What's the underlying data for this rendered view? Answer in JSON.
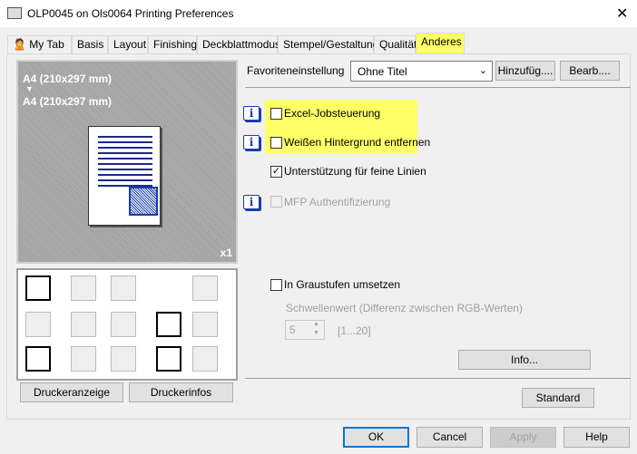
{
  "window": {
    "title": "OLP0045 on Ols0064 Printing Preferences",
    "close": "✕"
  },
  "tabs": [
    "My Tab",
    "Basis",
    "Layout",
    "Finishing",
    "Deckblattmodus",
    "Stempel/Gestaltung",
    "Qualität",
    "Anderes"
  ],
  "preview": {
    "paper_from": "A4 (210x297 mm)",
    "arrow": "▼",
    "paper_to": "A4 (210x297 mm)",
    "copies": "x1"
  },
  "left_buttons": {
    "printer_view": "Druckeranzeige",
    "printer_info": "Druckerinfos"
  },
  "favorites": {
    "label": "Favoriteneinstellung",
    "value": "Ohne Titel",
    "add": "Hinzufüg....",
    "edit": "Bearb...."
  },
  "options": [
    {
      "label": "Excel-Jobsteuerung",
      "checked": false,
      "enabled": true,
      "info": "i"
    },
    {
      "label": "Weißen Hintergrund entfernen",
      "checked": false,
      "enabled": true,
      "info": "i"
    },
    {
      "label": "Unterstützung für feine Linien",
      "checked": true,
      "enabled": true
    },
    {
      "label": "MFP Authentifizierung",
      "checked": false,
      "enabled": false,
      "info": "i"
    }
  ],
  "grayscale": {
    "label": "In Graustufen umsetzen",
    "threshold_label": "Schwellenwert (Differenz zwischen RGB-Werten)",
    "value": "5",
    "range": "[1...20]",
    "info_button": "Info..."
  },
  "standard": "Standard",
  "footer": {
    "ok": "OK",
    "cancel": "Cancel",
    "apply": "Apply",
    "help": "Help"
  },
  "colors": {
    "highlight": "#ffff66",
    "info": "#1a3ea8"
  }
}
